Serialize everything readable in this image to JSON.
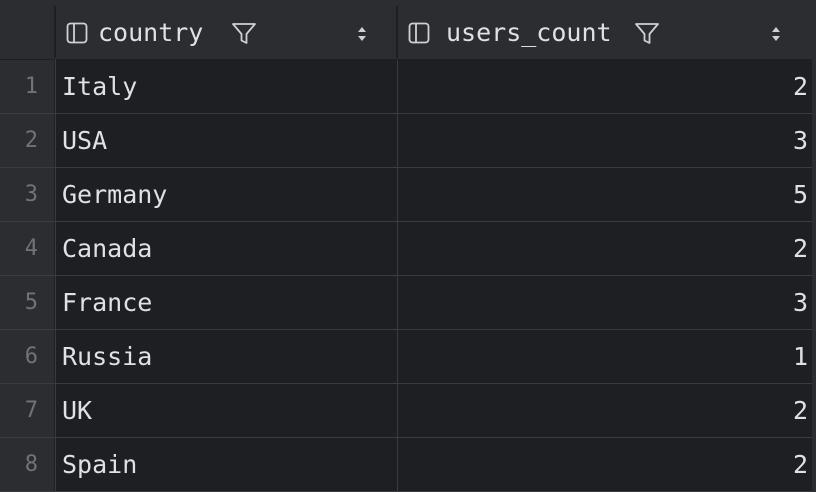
{
  "table": {
    "columns": [
      {
        "name": "country",
        "icon": "column-icon",
        "filter_icon": "filter-icon",
        "sort_icon": "sort-icon"
      },
      {
        "name": "users_count",
        "icon": "column-icon",
        "filter_icon": "filter-icon",
        "sort_icon": "sort-icon"
      }
    ],
    "rows": [
      {
        "num": "1",
        "country": "Italy",
        "users_count": "2"
      },
      {
        "num": "2",
        "country": "USA",
        "users_count": "3"
      },
      {
        "num": "3",
        "country": "Germany",
        "users_count": "5"
      },
      {
        "num": "4",
        "country": "Canada",
        "users_count": "2"
      },
      {
        "num": "5",
        "country": "France",
        "users_count": "3"
      },
      {
        "num": "6",
        "country": "Russia",
        "users_count": "1"
      },
      {
        "num": "7",
        "country": "UK",
        "users_count": "2"
      },
      {
        "num": "8",
        "country": "Spain",
        "users_count": "2"
      }
    ]
  },
  "colors": {
    "background": "#1e1f22",
    "header": "#2b2d30",
    "text": "#dfe1e5",
    "row_number": "#6f737a",
    "grid_line": "#393b40"
  }
}
